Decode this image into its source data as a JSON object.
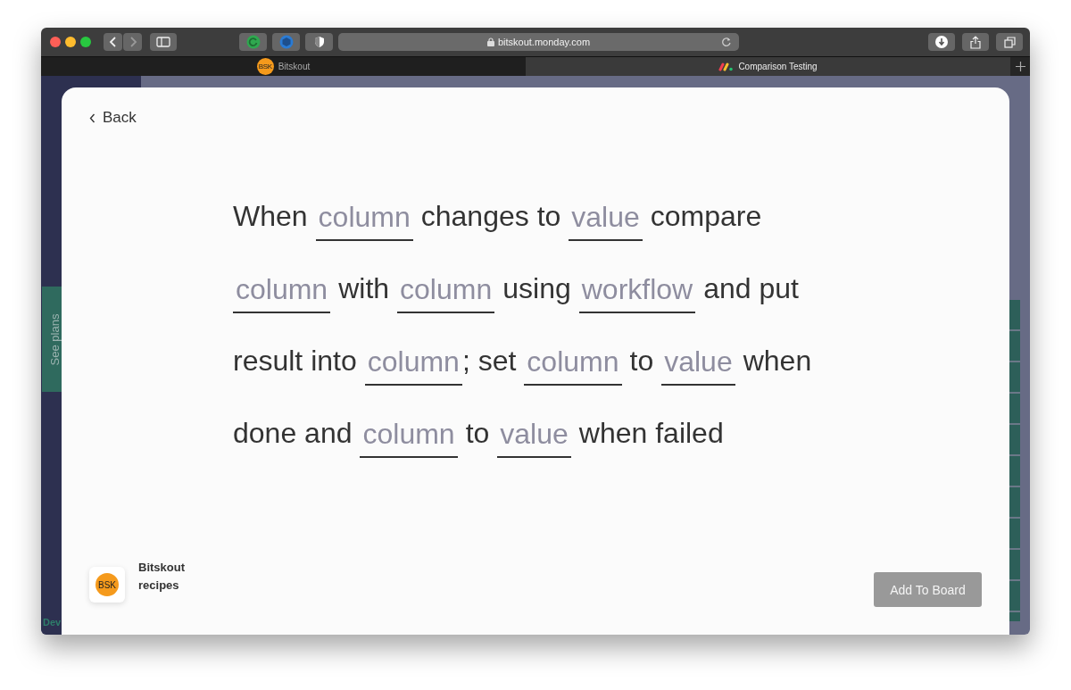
{
  "browser": {
    "address": "bitskout.monday.com",
    "tabs": [
      {
        "title": "Bitskout",
        "favicon_label": "BSK",
        "selected": false
      },
      {
        "title": "Comparison Testing",
        "selected": true
      }
    ]
  },
  "background": {
    "side_button": "See plans",
    "cut_label": "Dev"
  },
  "modal": {
    "back": "Back",
    "sentence_lines": [
      [
        {
          "kind": "text",
          "text": "When"
        },
        {
          "kind": "slot",
          "text": "column"
        },
        {
          "kind": "text",
          "text": "changes to"
        },
        {
          "kind": "slot",
          "text": "value"
        },
        {
          "kind": "text",
          "text": "compare"
        }
      ],
      [
        {
          "kind": "slot",
          "text": "column"
        },
        {
          "kind": "text",
          "text": "with"
        },
        {
          "kind": "slot",
          "text": "column"
        },
        {
          "kind": "text",
          "text": "using"
        },
        {
          "kind": "slot",
          "text": "workflow"
        },
        {
          "kind": "text",
          "text": "and put"
        }
      ],
      [
        {
          "kind": "text",
          "text": "result into"
        },
        {
          "kind": "slot",
          "text": "column"
        },
        {
          "kind": "text",
          "text": "; set",
          "tight": true
        },
        {
          "kind": "slot",
          "text": "column"
        },
        {
          "kind": "text",
          "text": "to"
        },
        {
          "kind": "slot",
          "text": "value"
        },
        {
          "kind": "text",
          "text": "when"
        }
      ],
      [
        {
          "kind": "text",
          "text": "done and"
        },
        {
          "kind": "slot",
          "text": "column"
        },
        {
          "kind": "text",
          "text": "to"
        },
        {
          "kind": "slot",
          "text": "value"
        },
        {
          "kind": "text",
          "text": "when failed"
        }
      ]
    ],
    "app": {
      "logo": "BSK",
      "name": "Bitskout recipes"
    },
    "add_button": {
      "label": "Add To Board",
      "disabled": true
    }
  }
}
